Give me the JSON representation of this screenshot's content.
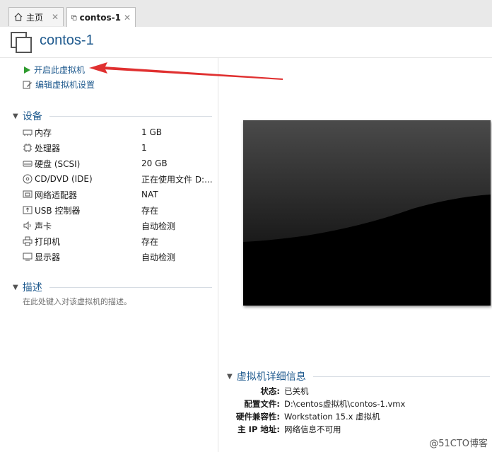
{
  "tabs": [
    {
      "label": "主页",
      "icon": "home-icon"
    },
    {
      "label": "contos-1",
      "icon": "vm-icon"
    }
  ],
  "title": "contos-1",
  "actions": {
    "power_on": "开启此虚拟机",
    "edit_settings": "编辑虚拟机设置"
  },
  "sections": {
    "devices": "设备",
    "description": "描述",
    "details": "虚拟机详细信息"
  },
  "devices": [
    {
      "name": "内存",
      "value": "1 GB",
      "icon": "memory-icon"
    },
    {
      "name": "处理器",
      "value": "1",
      "icon": "processor-icon"
    },
    {
      "name": "硬盘 (SCSI)",
      "value": "20 GB",
      "icon": "hard-disk-icon"
    },
    {
      "name": "CD/DVD (IDE)",
      "value": "正在使用文件 D:...",
      "icon": "cd-dvd-icon"
    },
    {
      "name": "网络适配器",
      "value": "NAT",
      "icon": "network-adapter-icon"
    },
    {
      "name": "USB 控制器",
      "value": "存在",
      "icon": "usb-icon"
    },
    {
      "name": "声卡",
      "value": "自动检测",
      "icon": "sound-card-icon"
    },
    {
      "name": "打印机",
      "value": "存在",
      "icon": "printer-icon"
    },
    {
      "name": "显示器",
      "value": "自动检测",
      "icon": "display-icon"
    }
  ],
  "description_placeholder": "在此处键入对该虚拟机的描述。",
  "details": [
    {
      "label": "状态:",
      "value": "已关机"
    },
    {
      "label": "配置文件:",
      "value": "D:\\centos虚拟机\\contos-1.vmx"
    },
    {
      "label": "硬件兼容性:",
      "value": "Workstation 15.x 虚拟机"
    },
    {
      "label": "主 IP 地址:",
      "value": "网络信息不可用"
    }
  ],
  "watermark": "@51CTO博客",
  "colors": {
    "accent": "#1f5a8e",
    "power_green": "#2e9b2e",
    "arrow_red": "#e03030"
  }
}
